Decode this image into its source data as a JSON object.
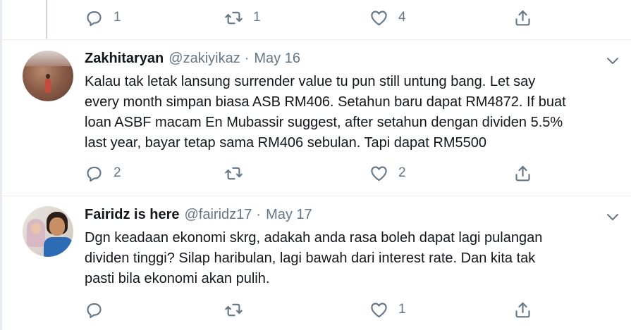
{
  "top_tweet": {
    "reply_count": "1",
    "retweet_count": "1",
    "like_count": "4"
  },
  "tweets": [
    {
      "name": "Zakhitaryan",
      "handle": "@zakiyikaz",
      "separator": "·",
      "date": "May 16",
      "text": "Kalau tak letak lansung surrender value tu pun still untung bang. Let say\nevery month simpan biasa ASB RM406. Setahun baru dapat RM4872. If buat\nloan ASBF macam En Mubassir suggest, after setahun dengan dividen 5.5%\nlast year, bayar tetap sama RM406 sebulan. Tapi dapat RM5500",
      "reply_count": "2",
      "retweet_count": "",
      "like_count": "2"
    },
    {
      "name": "Fairidz is here",
      "handle": "@fairidz17",
      "separator": "·",
      "date": "May 17",
      "text": "Dgn keadaan ekonomi skrg, adakah anda rasa boleh dapat lagi pulangan\ndividen tinggi? Silap haribulan, lagi bawah dari interest rate. Dan kita tak\npasti bila ekonomi akan pulih.",
      "reply_count": "",
      "retweet_count": "",
      "like_count": "1"
    }
  ],
  "icons": [
    "reply-icon",
    "retweet-icon",
    "like-icon",
    "share-icon",
    "chevron-down-icon"
  ],
  "colors": {
    "text": "#14171a",
    "secondary": "#657786",
    "divider": "#e6ecf0",
    "thread_line": "#ccd6dd"
  }
}
